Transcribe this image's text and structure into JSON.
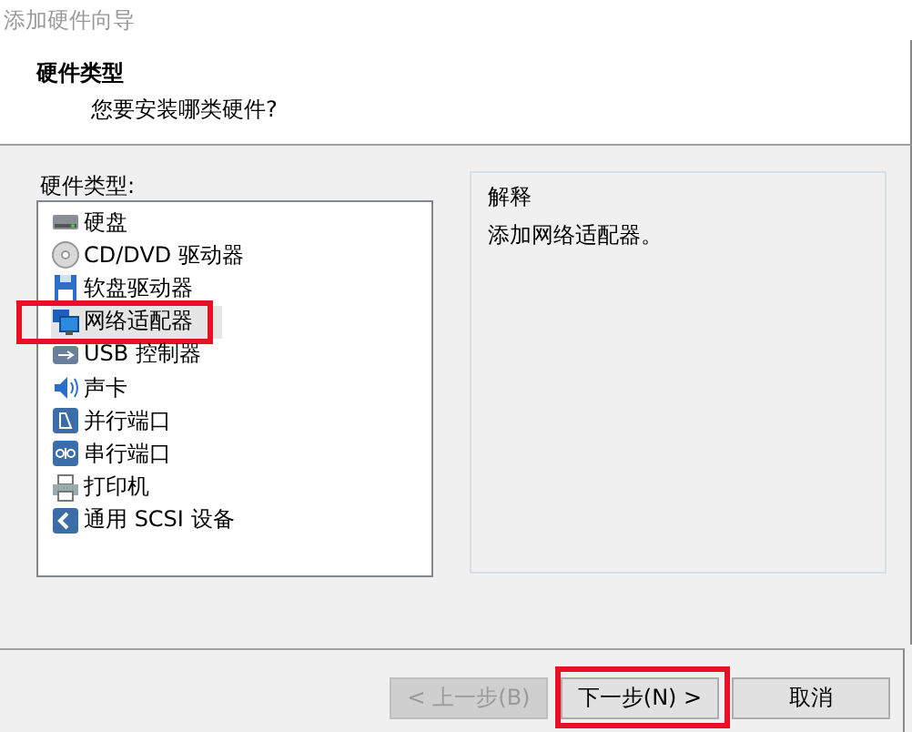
{
  "window": {
    "title": "添加硬件向导"
  },
  "header": {
    "title": "硬件类型",
    "subtitle": "您要安装哪类硬件?"
  },
  "hardware_list": {
    "label": "硬件类型:",
    "items": [
      {
        "label": "硬盘",
        "kind": "disk",
        "selected": false,
        "annotated": false
      },
      {
        "label": "CD/DVD 驱动器",
        "kind": "optical",
        "selected": false,
        "annotated": false
      },
      {
        "label": "软盘驱动器",
        "kind": "floppy",
        "selected": false,
        "annotated": false
      },
      {
        "label": "网络适配器",
        "kind": "network",
        "selected": true,
        "annotated": true
      },
      {
        "label": "USB 控制器",
        "kind": "usb",
        "selected": false,
        "annotated": false
      },
      {
        "label": "声卡",
        "kind": "sound",
        "selected": false,
        "annotated": false
      },
      {
        "label": "并行端口",
        "kind": "parallel",
        "selected": false,
        "annotated": false
      },
      {
        "label": "串行端口",
        "kind": "serial",
        "selected": false,
        "annotated": false
      },
      {
        "label": "打印机",
        "kind": "printer",
        "selected": false,
        "annotated": false
      },
      {
        "label": "通用 SCSI 设备",
        "kind": "scsi",
        "selected": false,
        "annotated": false
      }
    ]
  },
  "explanation": {
    "title": "解释",
    "text": "添加网络适配器。"
  },
  "buttons": [
    {
      "label": "< 上一步(B)",
      "disabled": true,
      "annotated": false
    },
    {
      "label": "下一步(N) >",
      "disabled": false,
      "annotated": true
    },
    {
      "label": "取消",
      "disabled": false,
      "annotated": false
    }
  ]
}
